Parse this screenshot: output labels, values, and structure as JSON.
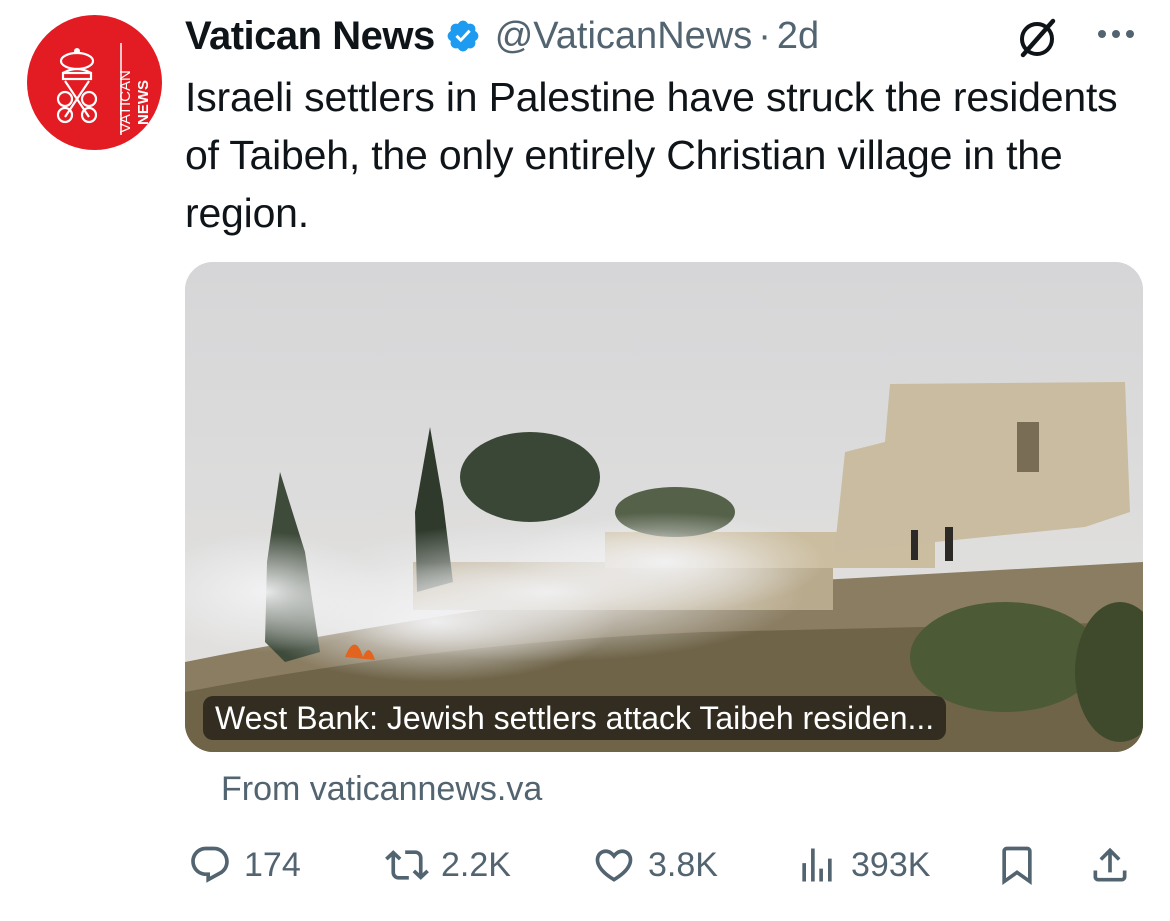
{
  "tweet": {
    "author_name": "Vatican News",
    "handle": "@VaticanNews",
    "separator": "·",
    "time": "2d",
    "text": "Israeli settlers in Palestine have struck the residents of Taibeh, the only entirely Christian village in the region.",
    "avatar": {
      "line1": "VATICAN",
      "line2": "NEWS",
      "color": "#e31b23"
    },
    "verified_color": "#1d9bf0"
  },
  "card": {
    "caption": "West Bank: Jewish settlers attack Taibeh residen...",
    "source": "From vaticannews.va"
  },
  "actions": {
    "replies": "174",
    "retweets": "2.2K",
    "likes": "3.8K",
    "views": "393K"
  },
  "icons": [
    "grok-icon",
    "more-icon",
    "reply-icon",
    "retweet-icon",
    "like-icon",
    "views-icon",
    "bookmark-icon",
    "share-icon"
  ]
}
